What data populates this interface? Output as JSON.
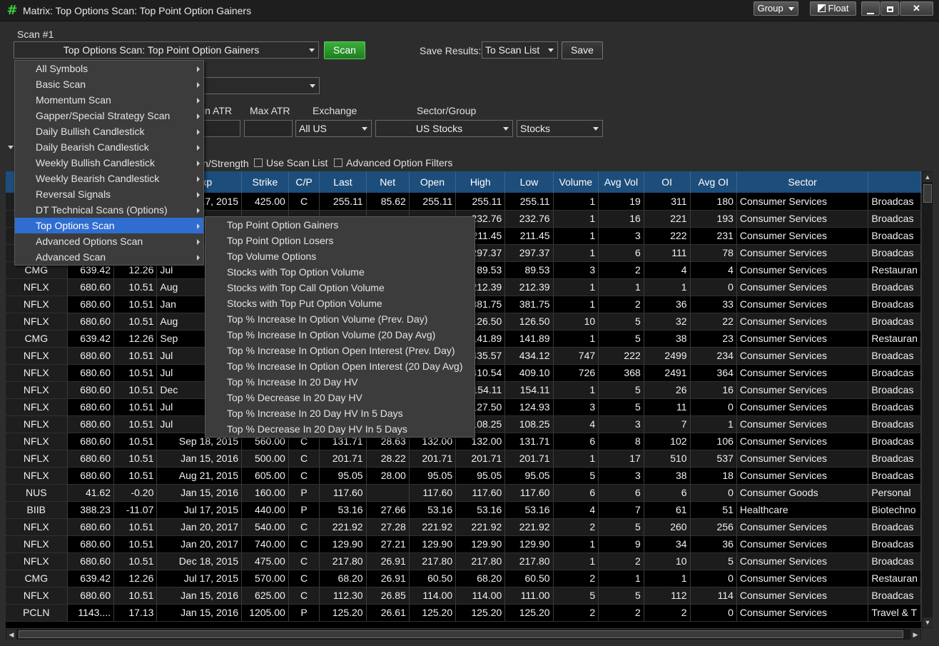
{
  "window": {
    "title": "Matrix: Top Options Scan: Top Point Option Gainers",
    "group_label": "Group",
    "float_label": "Float"
  },
  "scan": {
    "scan_number_label": "Scan #1",
    "selected_scan": "Top Options Scan: Top Point Option Gainers",
    "scan_button": "Scan",
    "save_results_label": "Save Results:",
    "save_results_value": "To Scan List",
    "save_button": "Save"
  },
  "filters": {
    "min_atr_label": "in ATR",
    "max_atr_label": "Max ATR",
    "exchange_label": "Exchange",
    "exchange_value": "All US",
    "sector_group_label": "Sector/Group",
    "sector_value": "US Stocks",
    "type_value": "Stocks",
    "strength_label": "n/Strength",
    "use_scan_list_label": "Use Scan List",
    "advanced_option_filters_label": "Advanced Option Filters"
  },
  "scan_menu": [
    "All Symbols",
    "Basic Scan",
    "Momentum Scan",
    "Gapper/Special Strategy Scan",
    "Daily Bullish Candlestick",
    "Daily Bearish Candlestick",
    "Weekly Bullish Candlestick",
    "Weekly Bearish Candlestick",
    "Reversal Signals",
    "DT Technical Scans (Options)",
    "Top Options Scan",
    "Advanced Options Scan",
    "Advanced Scan"
  ],
  "scan_menu_active": "Top Options Scan",
  "submenu": [
    "Top Point Option Gainers",
    "Top Point Option Losers",
    "Top Volume Options",
    "Stocks with Top Option Volume",
    "Stocks with Top Call Option Volume",
    "Stocks with Top Put Option Volume",
    "Top % Increase In Option Volume (Prev. Day)",
    "Top % Increase In Option Volume (20 Day Avg)",
    "Top % Increase In Option Open Interest (Prev. Day)",
    "Top % Increase In Option Open Interest (20 Day Avg)",
    "Top % Increase In 20 Day HV",
    "Top % Decrease In 20 Day HV",
    "Top % Increase In 20 Day HV In 5 Days",
    "Top % Decrease In 20 Day HV In 5 Days"
  ],
  "grid": {
    "headers": [
      "",
      "",
      "",
      "n Exp",
      "Strike",
      "C/P",
      "Last",
      "Net",
      "Open",
      "High",
      "Low",
      "Volume",
      "Avg Vol",
      "OI",
      "Avg OI",
      "Sector",
      ""
    ],
    "rows": [
      [
        "",
        "",
        "",
        " 17, 2015",
        "425.00",
        "C",
        "255.11",
        "85.62",
        "255.11",
        "255.11",
        "255.11",
        "1",
        "19",
        "311",
        "180",
        "Consumer Services",
        "Broadcas"
      ],
      [
        "",
        "",
        "",
        "",
        "",
        "",
        "",
        "",
        "",
        "232.76",
        "232.76",
        "1",
        "16",
        "221",
        "193",
        "Consumer Services",
        "Broadcas"
      ],
      [
        "",
        "",
        "",
        "",
        "",
        "",
        "",
        "",
        "",
        "211.45",
        "211.45",
        "1",
        "3",
        "222",
        "231",
        "Consumer Services",
        "Broadcas"
      ],
      [
        "",
        "",
        "",
        "",
        "",
        "",
        "",
        "",
        "",
        "297.37",
        "297.37",
        "1",
        "6",
        "111",
        "78",
        "Consumer Services",
        "Broadcas"
      ],
      [
        "CMG",
        "639.42",
        "12.26",
        "Jul",
        "",
        "",
        "",
        "",
        "",
        "89.53",
        "89.53",
        "3",
        "2",
        "4",
        "4",
        "Consumer Services",
        "Restauran"
      ],
      [
        "NFLX",
        "680.60",
        "10.51",
        "Aug",
        "",
        "",
        "",
        "",
        "",
        "212.39",
        "212.39",
        "1",
        "1",
        "1",
        "0",
        "Consumer Services",
        "Broadcas"
      ],
      [
        "NFLX",
        "680.60",
        "10.51",
        "Jan",
        "",
        "",
        "",
        "",
        "",
        "381.75",
        "381.75",
        "1",
        "2",
        "36",
        "33",
        "Consumer Services",
        "Broadcas"
      ],
      [
        "NFLX",
        "680.60",
        "10.51",
        "Aug",
        "",
        "",
        "",
        "",
        "",
        "126.50",
        "126.50",
        "10",
        "5",
        "32",
        "22",
        "Consumer Services",
        "Broadcas"
      ],
      [
        "CMG",
        "639.42",
        "12.26",
        "Sep",
        "",
        "",
        "",
        "",
        "",
        "141.89",
        "141.89",
        "1",
        "5",
        "38",
        "23",
        "Consumer Services",
        "Restauran"
      ],
      [
        "NFLX",
        "680.60",
        "10.51",
        "Jul",
        "",
        "",
        "",
        "",
        "",
        "435.57",
        "434.12",
        "747",
        "222",
        "2499",
        "234",
        "Consumer Services",
        "Broadcas"
      ],
      [
        "NFLX",
        "680.60",
        "10.51",
        "Jul",
        "",
        "",
        "",
        "",
        "",
        "410.54",
        "409.10",
        "726",
        "368",
        "2491",
        "364",
        "Consumer Services",
        "Broadcas"
      ],
      [
        "NFLX",
        "680.60",
        "10.51",
        "Dec",
        "",
        "",
        "",
        "",
        "",
        "154.11",
        "154.11",
        "1",
        "5",
        "26",
        "16",
        "Consumer Services",
        "Broadcas"
      ],
      [
        "NFLX",
        "680.60",
        "10.51",
        "Jul",
        "",
        "",
        "",
        "",
        "",
        "127.50",
        "124.93",
        "3",
        "5",
        "11",
        "0",
        "Consumer Services",
        "Broadcas"
      ],
      [
        "NFLX",
        "680.60",
        "10.51",
        "Jul",
        "",
        "",
        "",
        "",
        "",
        "108.25",
        "108.25",
        "4",
        "3",
        "7",
        "1",
        "Consumer Services",
        "Broadcas"
      ],
      [
        "NFLX",
        "680.60",
        "10.51",
        "Sep 18, 2015",
        "560.00",
        "C",
        "131.71",
        "28.63",
        "132.00",
        "132.00",
        "131.71",
        "6",
        "8",
        "102",
        "106",
        "Consumer Services",
        "Broadcas"
      ],
      [
        "NFLX",
        "680.60",
        "10.51",
        "Jan 15, 2016",
        "500.00",
        "C",
        "201.71",
        "28.22",
        "201.71",
        "201.71",
        "201.71",
        "1",
        "17",
        "510",
        "537",
        "Consumer Services",
        "Broadcas"
      ],
      [
        "NFLX",
        "680.60",
        "10.51",
        "Aug 21, 2015",
        "605.00",
        "C",
        "95.05",
        "28.00",
        "95.05",
        "95.05",
        "95.05",
        "5",
        "3",
        "38",
        "18",
        "Consumer Services",
        "Broadcas"
      ],
      [
        "NUS",
        "41.62",
        "-0.20",
        "Jan 15, 2016",
        "160.00",
        "P",
        "117.60",
        "",
        "117.60",
        "117.60",
        "117.60",
        "6",
        "6",
        "6",
        "0",
        "Consumer Goods",
        "Personal"
      ],
      [
        "BIIB",
        "388.23",
        "-11.07",
        "Jul 17, 2015",
        "440.00",
        "P",
        "53.16",
        "27.66",
        "53.16",
        "53.16",
        "53.16",
        "4",
        "7",
        "61",
        "51",
        "Healthcare",
        "Biotechno"
      ],
      [
        "NFLX",
        "680.60",
        "10.51",
        "Jan 20, 2017",
        "540.00",
        "C",
        "221.92",
        "27.28",
        "221.92",
        "221.92",
        "221.92",
        "2",
        "5",
        "260",
        "256",
        "Consumer Services",
        "Broadcas"
      ],
      [
        "NFLX",
        "680.60",
        "10.51",
        "Jan 20, 2017",
        "740.00",
        "C",
        "129.90",
        "27.21",
        "129.90",
        "129.90",
        "129.90",
        "1",
        "9",
        "34",
        "36",
        "Consumer Services",
        "Broadcas"
      ],
      [
        "NFLX",
        "680.60",
        "10.51",
        "Dec 18, 2015",
        "475.00",
        "C",
        "217.80",
        "26.91",
        "217.80",
        "217.80",
        "217.80",
        "1",
        "2",
        "10",
        "5",
        "Consumer Services",
        "Broadcas"
      ],
      [
        "CMG",
        "639.42",
        "12.26",
        "Jul 17, 2015",
        "570.00",
        "C",
        "68.20",
        "26.91",
        "60.50",
        "68.20",
        "60.50",
        "2",
        "1",
        "1",
        "0",
        "Consumer Services",
        "Restauran"
      ],
      [
        "NFLX",
        "680.60",
        "10.51",
        "Jan 15, 2016",
        "625.00",
        "C",
        "112.30",
        "26.85",
        "114.00",
        "114.00",
        "111.00",
        "5",
        "5",
        "112",
        "114",
        "Consumer Services",
        "Broadcas"
      ],
      [
        "PCLN",
        "1143....",
        "17.13",
        "Jan 15, 2016",
        "1205.00",
        "P",
        "125.20",
        "26.61",
        "125.20",
        "125.20",
        "125.20",
        "2",
        "2",
        "2",
        "0",
        "Consumer Services",
        "Travel & T"
      ]
    ]
  }
}
